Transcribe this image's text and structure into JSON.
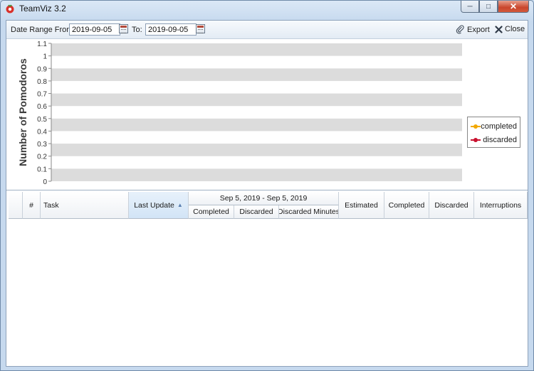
{
  "window": {
    "title": "TeamViz 3.2",
    "controls": [
      "minimize",
      "maximize",
      "close"
    ]
  },
  "toolbar": {
    "date_from_label": "Date Range From:",
    "date_from_value": "2019-09-05",
    "date_to_label": "To:",
    "date_to_value": "2019-09-05",
    "export_label": "Export",
    "close_label": "Close"
  },
  "chart_data": {
    "type": "line",
    "title": "",
    "xlabel": "",
    "ylabel": "Number of Pomodoros",
    "ylim": [
      0,
      1.1
    ],
    "y_ticks": [
      "0",
      "0.1",
      "0.2",
      "0.3",
      "0.4",
      "0.5",
      "0.6",
      "0.7",
      "0.8",
      "0.9",
      "1",
      "1.1"
    ],
    "categories": [],
    "series": [
      {
        "name": "completed",
        "color": "#f2a900",
        "values": []
      },
      {
        "name": "discarded",
        "color": "#c9102e",
        "values": []
      }
    ],
    "grid": true,
    "legend_position": "right"
  },
  "table": {
    "columns": {
      "index": "#",
      "task": "Task",
      "last_update": "Last Update",
      "period_group": "Sep 5, 2019 - Sep 5, 2019",
      "completed_sub": "Completed",
      "discarded_sub": "Discarded",
      "discarded_minutes_sub": "Discarded Minutes",
      "estimated": "Estimated",
      "completed": "Completed",
      "discarded": "Discarded",
      "interruptions": "Interruptions"
    },
    "sorted_column": "last_update",
    "sort_direction": "ascending",
    "rows": []
  }
}
